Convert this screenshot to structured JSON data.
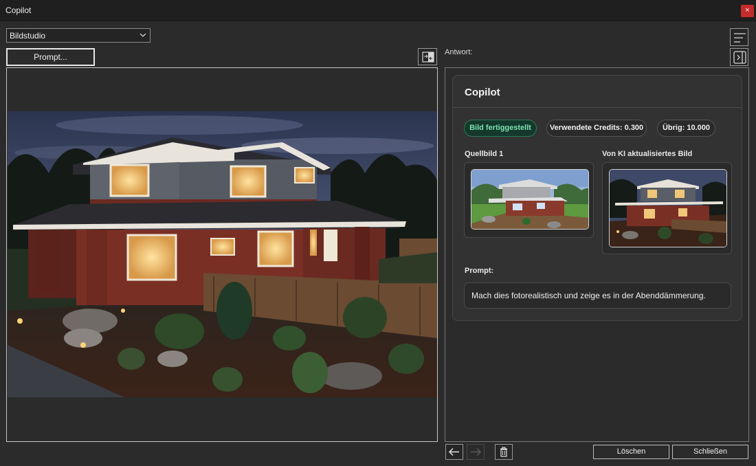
{
  "window": {
    "title": "Copilot",
    "close_label": "×"
  },
  "left": {
    "mode_select": {
      "value": "Bildstudio"
    },
    "prompt_button": "Prompt..."
  },
  "right": {
    "answer_label": "Antwort:",
    "card": {
      "title": "Copilot",
      "status_badge": "Bild fertiggestellt",
      "credits_used": "Verwendete Credits: 0.300",
      "credits_left": "Übrig: 10.000",
      "source_label": "Quellbild 1",
      "result_label": "Von KI aktualisiertes Bild",
      "prompt_label": "Prompt:",
      "prompt_text": "Mach dies fotorealistisch und zeige es in der Abenddämmerung."
    }
  },
  "footer": {
    "delete_label": "Löschen",
    "close_label": "Schließen"
  },
  "icons": {
    "menu": "lines-menu-icon",
    "swap": "swap-panels-icon",
    "collapse": "collapse-panel-icon",
    "back": "arrow-left-icon",
    "forward": "arrow-right-icon",
    "trash": "trash-icon"
  },
  "colors": {
    "accent_green": "#7de0b2",
    "close_red": "#c42b2b"
  }
}
